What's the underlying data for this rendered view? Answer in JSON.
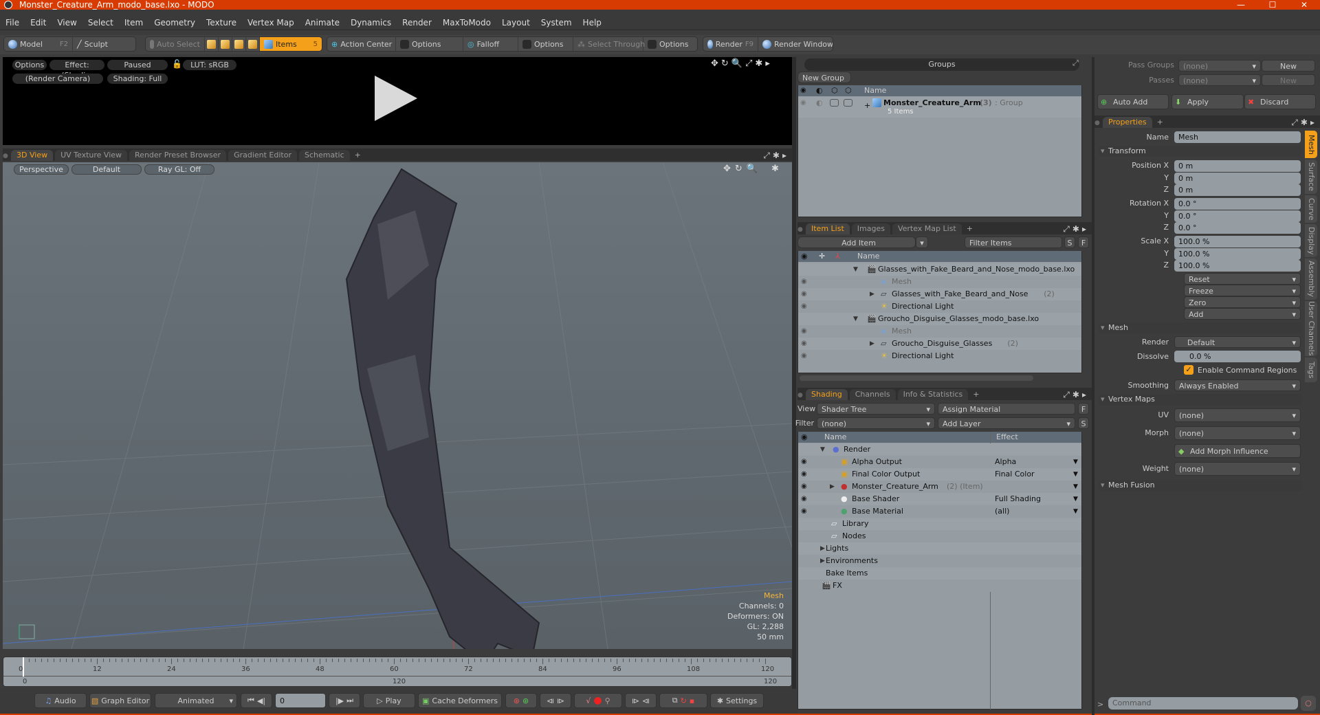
{
  "window": {
    "title": "Monster_Creature_Arm_modo_base.lxo - MODO",
    "controls": {
      "minimize": "—",
      "maximize": "☐",
      "close": "✕"
    }
  },
  "menu": [
    "File",
    "Edit",
    "View",
    "Select",
    "Item",
    "Geometry",
    "Texture",
    "Vertex Map",
    "Animate",
    "Dynamics",
    "Render",
    "MaxToModo",
    "Layout",
    "System",
    "Help"
  ],
  "toolbar": {
    "model": "Model",
    "model_shortcut": "F2",
    "sculpt": "Sculpt",
    "auto_select": "Auto Select",
    "items": "Items",
    "items_shortcut": "5",
    "action_center": "Action Center",
    "options1": "Options",
    "falloff": "Falloff",
    "options2": "Options",
    "select_through": "Select Through",
    "options3": "Options",
    "render": "Render",
    "render_shortcut": "F9",
    "render_window": "Render Window"
  },
  "preview": {
    "options": "Options",
    "effect": "Effect: (Shadi...",
    "paused": "Paused",
    "lut": "LUT: sRGB",
    "camera": "(Render Camera)",
    "shading": "Shading: Full"
  },
  "viewport_tabs": [
    "3D View",
    "UV Texture View",
    "Render Preset Browser",
    "Gradient Editor",
    "Schematic",
    "+"
  ],
  "viewport": {
    "projection": "Perspective",
    "style": "Default",
    "raygl": "Ray GL: Off",
    "info": {
      "selection": "Mesh",
      "channels": "Channels: 0",
      "deformers": "Deformers: ON",
      "gl": "GL: 2,288",
      "lens": "50 mm"
    }
  },
  "timeline": {
    "ticks": [
      "0",
      "12",
      "24",
      "36",
      "48",
      "60",
      "72",
      "84",
      "96",
      "108",
      "120"
    ],
    "range_start": "0",
    "range_mid": "120",
    "range_end": "120",
    "current_frame": 0
  },
  "transport": {
    "audio": "Audio",
    "graph_editor": "Graph Editor",
    "mode": "Animated",
    "frame": "0",
    "play": "Play",
    "cache": "Cache Deformers",
    "settings": "Settings"
  },
  "groups": {
    "header": "Groups",
    "new_group": "New Group",
    "col_name": "Name",
    "rows": [
      {
        "name": "Monster_Creature_Arm",
        "count": "(3)",
        "type": ": Group",
        "sub": "5 Items"
      }
    ]
  },
  "passes": {
    "pass_groups_label": "Pass Groups",
    "pass_groups_value": "(none)",
    "passes_label": "Passes",
    "passes_value": "(none)",
    "new": "New",
    "auto_add": "Auto Add",
    "apply": "Apply",
    "discard": "Discard"
  },
  "item_list": {
    "tabs": [
      "Item List",
      "Images",
      "Vertex Map List",
      "+"
    ],
    "add_item": "Add Item",
    "filter": "Filter Items",
    "s": "S",
    "f": "F",
    "col_name": "Name",
    "rows": [
      {
        "name": "Glasses_with_Fake_Beard_and_Nose_modo_base.lxo",
        "count": "",
        "level": 0,
        "kind": "scene",
        "dim": false
      },
      {
        "name": "Mesh",
        "count": "",
        "level": 1,
        "kind": "mesh",
        "dim": true
      },
      {
        "name": "Glasses_with_Fake_Beard_and_Nose",
        "count": "(2)",
        "level": 1,
        "kind": "group",
        "dim": false
      },
      {
        "name": "Directional Light",
        "count": "",
        "level": 1,
        "kind": "light",
        "dim": false
      },
      {
        "name": "Groucho_Disguise_Glasses_modo_base.lxo",
        "count": "",
        "level": 0,
        "kind": "scene",
        "dim": false
      },
      {
        "name": "Mesh",
        "count": "",
        "level": 1,
        "kind": "mesh",
        "dim": true
      },
      {
        "name": "Groucho_Disguise_Glasses",
        "count": "(2)",
        "level": 1,
        "kind": "group",
        "dim": false
      },
      {
        "name": "Directional Light",
        "count": "",
        "level": 1,
        "kind": "light",
        "dim": false
      }
    ]
  },
  "shading": {
    "tabs": [
      "Shading",
      "Channels",
      "Info & Statistics",
      "+"
    ],
    "view_label": "View",
    "view_value": "Shader Tree",
    "assign_material": "Assign Material",
    "filter_label": "Filter",
    "filter_value": "(none)",
    "add_layer": "Add Layer",
    "f": "F",
    "s": "S",
    "col_name": "Name",
    "col_effect": "Effect",
    "rows": [
      {
        "name": "Render",
        "effect": "",
        "extra": ""
      },
      {
        "name": "Alpha Output",
        "effect": "Alpha",
        "extra": ""
      },
      {
        "name": "Final Color Output",
        "effect": "Final Color",
        "extra": ""
      },
      {
        "name": "Monster_Creature_Arm",
        "effect": "",
        "extra": "(2) (Item)"
      },
      {
        "name": "Base Shader",
        "effect": "Full Shading",
        "extra": ""
      },
      {
        "name": "Base Material",
        "effect": "(all)",
        "extra": ""
      },
      {
        "name": "Library",
        "effect": "",
        "extra": ""
      },
      {
        "name": "Nodes",
        "effect": "",
        "extra": ""
      },
      {
        "name": "Lights",
        "effect": "",
        "extra": ""
      },
      {
        "name": "Environments",
        "effect": "",
        "extra": ""
      },
      {
        "name": "Bake Items",
        "effect": "",
        "extra": ""
      },
      {
        "name": "FX",
        "effect": "",
        "extra": ""
      }
    ]
  },
  "properties": {
    "tab": "Properties",
    "name_label": "Name",
    "name_value": "Mesh",
    "transform": "Transform",
    "position": {
      "label": "Position X",
      "x": "0 m",
      "y": "0 m",
      "z": "0 m"
    },
    "rotation": {
      "label": "Rotation X",
      "x": "0.0 °",
      "y": "0.0 °",
      "z": "0.0 °"
    },
    "scale": {
      "label": "Scale X",
      "x": "100.0 %",
      "y": "100.0 %",
      "z": "100.0 %"
    },
    "axis_y": "Y",
    "axis_z": "Z",
    "actions": [
      "Reset",
      "Freeze",
      "Zero",
      "Add"
    ],
    "mesh": "Mesh",
    "render_label": "Render",
    "render_value": "Default",
    "dissolve_label": "Dissolve",
    "dissolve_value": "0.0 %",
    "enable_cmd_regions": "Enable Command Regions",
    "enable_cmd_regions_checked": true,
    "smoothing_label": "Smoothing",
    "smoothing_value": "Always Enabled",
    "vertex_maps": "Vertex Maps",
    "uv_label": "UV",
    "uv_value": "(none)",
    "morph_label": "Morph",
    "morph_value": "(none)",
    "add_morph": "Add Morph Influence",
    "weight_label": "Weight",
    "weight_value": "(none)",
    "mesh_fusion": "Mesh Fusion",
    "side_tabs": [
      "Mesh",
      "Surface",
      "Curve",
      "Display",
      "Assembly",
      "User Channels",
      "Tags"
    ]
  },
  "command": {
    "prompt": ">",
    "placeholder": "Command"
  },
  "colors": {
    "accent": "#f5a01a",
    "titlebar": "#d83b01"
  }
}
